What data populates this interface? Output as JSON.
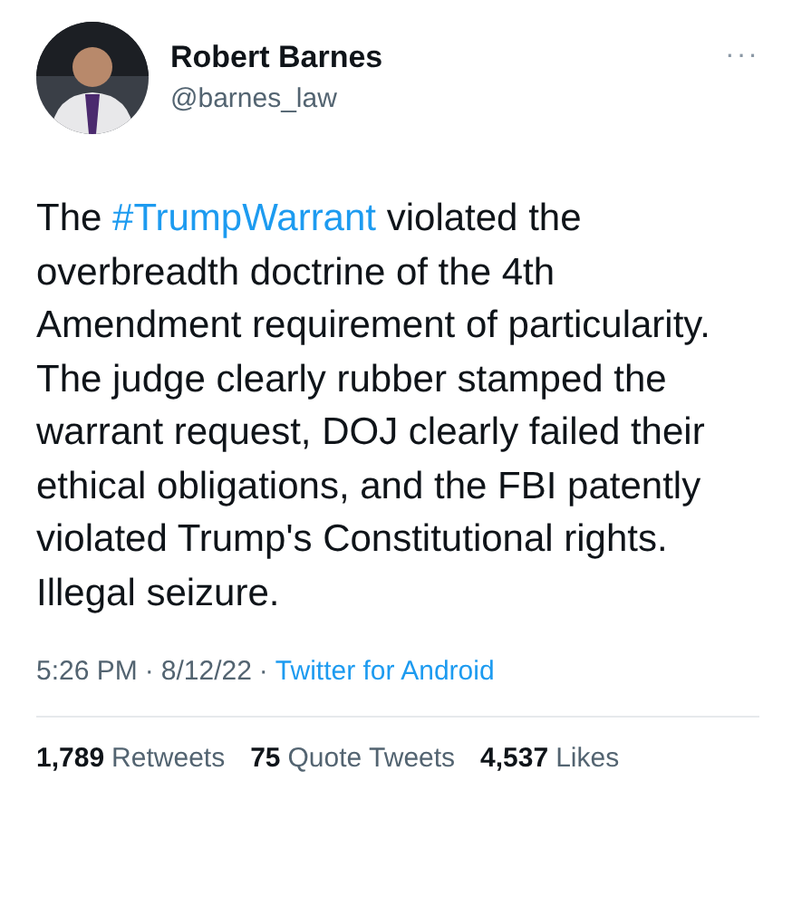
{
  "author": {
    "name": "Robert Barnes",
    "handle": "@barnes_law"
  },
  "more_menu": "···",
  "tweet": {
    "before": "The ",
    "hashtag": "#TrumpWarrant",
    "after": " violated the overbreadth doctrine of the 4th Amendment requirement of particularity. The judge clearly rubber stamped the warrant request, DOJ clearly failed their ethical obligations, and the FBI patently violated Trump's Constitutional rights. Illegal seizure."
  },
  "meta": {
    "time": "5:26 PM",
    "separator": "·",
    "date": "8/12/22",
    "separator_2": "·",
    "source": "Twitter for Android"
  },
  "stats": [
    {
      "count": "1,789",
      "label": "Retweets"
    },
    {
      "count": "75",
      "label": "Quote Tweets"
    },
    {
      "count": "4,537",
      "label": "Likes"
    }
  ]
}
